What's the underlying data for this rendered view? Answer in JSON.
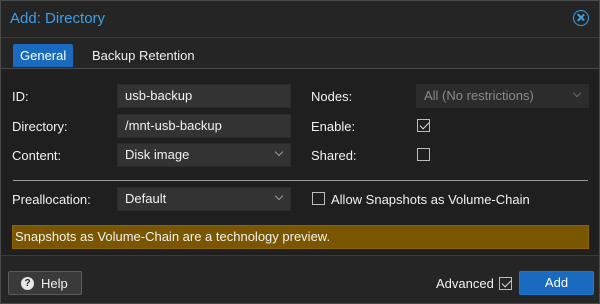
{
  "window": {
    "title": "Add: Directory"
  },
  "tabs": [
    {
      "label": "General",
      "active": true
    },
    {
      "label": "Backup Retention",
      "active": false
    }
  ],
  "form": {
    "id_label": "ID:",
    "id_value": "usb-backup",
    "directory_label": "Directory:",
    "directory_value": "/mnt-usb-backup",
    "content_label": "Content:",
    "content_value": "Disk image",
    "nodes_label": "Nodes:",
    "nodes_value": "All (No restrictions)",
    "enable_label": "Enable:",
    "enable_checked": true,
    "shared_label": "Shared:",
    "shared_checked": false,
    "preallocation_label": "Preallocation:",
    "preallocation_value": "Default",
    "snapshots_label": "Allow Snapshots as Volume-Chain",
    "snapshots_checked": false
  },
  "notice": {
    "text": "Snapshots as Volume-Chain are a technology preview."
  },
  "footer": {
    "help_label": "Help",
    "advanced_label": "Advanced",
    "advanced_checked": true,
    "add_label": "Add"
  },
  "colors": {
    "accent": "#1a6bbf",
    "title": "#3fa0e6",
    "warning_bg": "#7a5600"
  },
  "icons": [
    "close-icon",
    "help-icon",
    "chevron-down-icon",
    "checkbox-icon"
  ]
}
